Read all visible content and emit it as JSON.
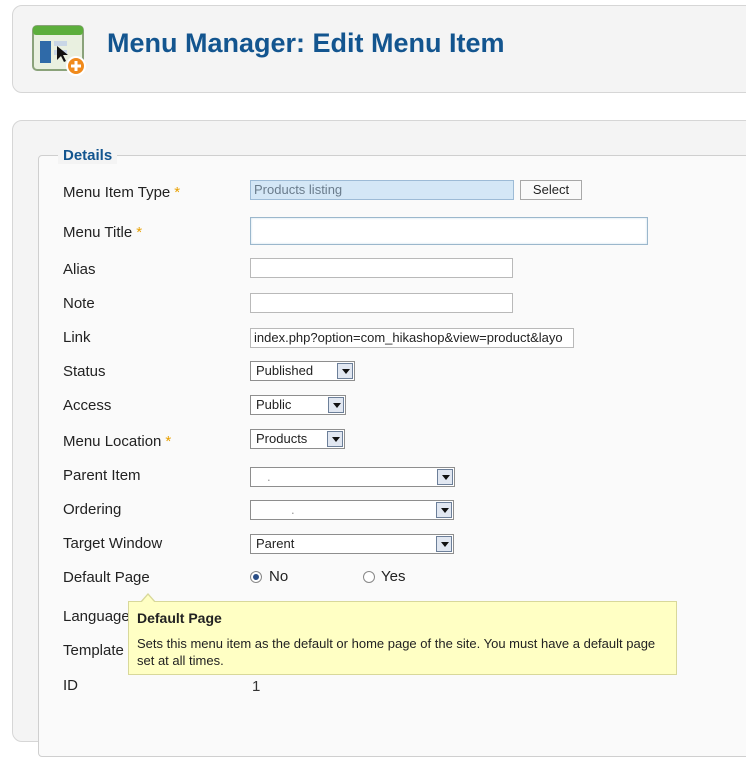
{
  "header": {
    "title": "Menu Manager: Edit Menu Item",
    "icon": "menu-edit-icon"
  },
  "details": {
    "legend": "Details",
    "required_mark": "*",
    "menu_item_type": {
      "label": "Menu Item Type",
      "value": "Products listing",
      "button": "Select"
    },
    "menu_title": {
      "label": "Menu Title",
      "value": ""
    },
    "alias": {
      "label": "Alias",
      "value": ""
    },
    "note": {
      "label": "Note",
      "value": ""
    },
    "link": {
      "label": "Link",
      "value": "index.php?option=com_hikashop&view=product&layo"
    },
    "status": {
      "label": "Status",
      "value": "Published"
    },
    "access": {
      "label": "Access",
      "value": "Public"
    },
    "menu_location": {
      "label": "Menu Location",
      "value": "Products"
    },
    "parent_item": {
      "label": "Parent Item",
      "value": "."
    },
    "ordering": {
      "label": "Ordering",
      "value": "."
    },
    "target_window": {
      "label": "Target Window",
      "value": "Parent"
    },
    "default_page": {
      "label": "Default Page",
      "options": [
        "No",
        "Yes"
      ],
      "selected": "No"
    },
    "language": {
      "label": "Language"
    },
    "template_style": {
      "label": "Template"
    },
    "id": {
      "label": "ID",
      "value": "1"
    }
  },
  "tooltip": {
    "title": "Default Page",
    "text": "Sets this menu item as the default or home page of the site. You must have a default page set at all times."
  },
  "colors": {
    "title": "#13558f",
    "required": "#e8a000",
    "tooltip_bg": "#ffffc4",
    "readonly_bg": "#d4e7f6"
  }
}
